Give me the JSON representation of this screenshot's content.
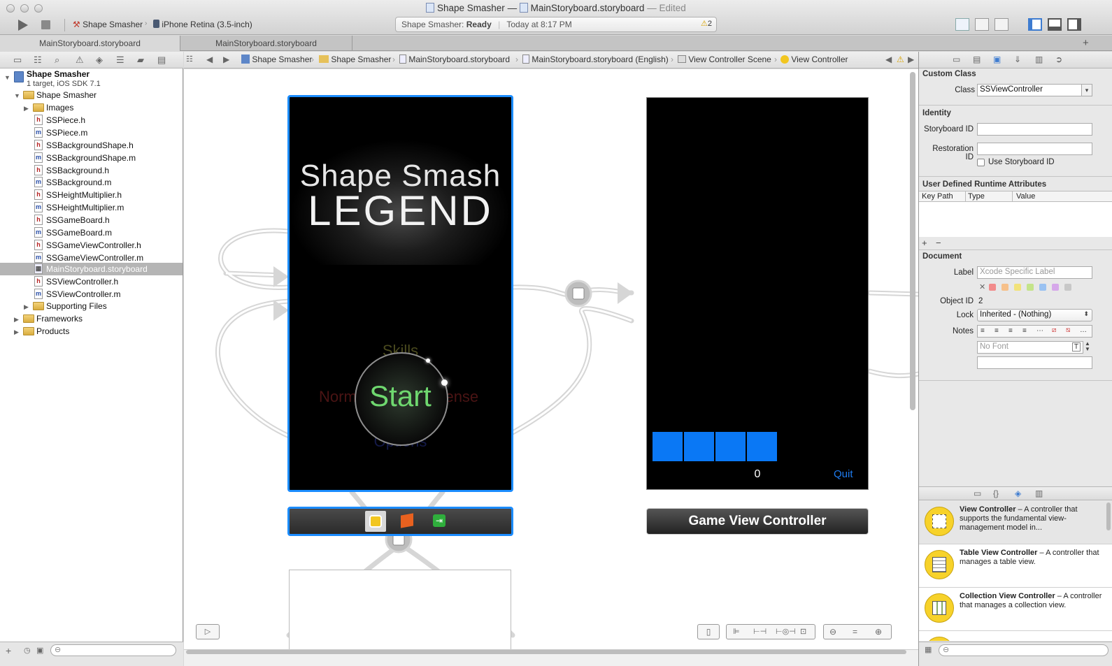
{
  "window": {
    "title_app": "Shape Smasher",
    "title_sep": "—",
    "title_file": "MainStoryboard.storyboard",
    "title_status": "— Edited"
  },
  "toolbar": {
    "scheme": "Shape Smasher",
    "destination": "iPhone Retina (3.5-inch)",
    "status_app": "Shape Smasher:",
    "status_state": "Ready",
    "status_time": "Today at 8:17 PM",
    "warning_count": "2"
  },
  "tabs": [
    {
      "label": "MainStoryboard.storyboard"
    },
    {
      "label": "MainStoryboard.storyboard"
    }
  ],
  "navigator": {
    "project_name": "Shape Smasher",
    "project_sub": "1 target, iOS SDK 7.1",
    "items": [
      {
        "label": "Shape Smasher"
      },
      {
        "label": "Images"
      },
      {
        "label": "SSPiece.h"
      },
      {
        "label": "SSPiece.m"
      },
      {
        "label": "SSBackgroundShape.h"
      },
      {
        "label": "SSBackgroundShape.m"
      },
      {
        "label": "SSBackground.h"
      },
      {
        "label": "SSBackground.m"
      },
      {
        "label": "SSHeightMultiplier.h"
      },
      {
        "label": "SSHeightMultiplier.m"
      },
      {
        "label": "SSGameBoard.h"
      },
      {
        "label": "SSGameBoard.m"
      },
      {
        "label": "SSGameViewController.h"
      },
      {
        "label": "SSGameViewController.m"
      },
      {
        "label": "MainStoryboard.storyboard"
      },
      {
        "label": "SSViewController.h"
      },
      {
        "label": "SSViewController.m"
      },
      {
        "label": "Supporting Files"
      },
      {
        "label": "Frameworks"
      },
      {
        "label": "Products"
      }
    ]
  },
  "jumpbar": {
    "crumbs": [
      "Shape Smasher",
      "Shape Smasher",
      "MainStoryboard.storyboard",
      "MainStoryboard.storyboard (English)",
      "View Controller Scene",
      "View Controller"
    ]
  },
  "canvas": {
    "splash_title": "Shape Smash",
    "splash_subtitle": "LEGEND",
    "menu_skills": "Skills",
    "menu_normal": "Normal",
    "menu_start": "Start",
    "menu_intense": "Intense",
    "menu_options": "Options",
    "game_score": "0",
    "game_quit": "Quit",
    "game_scene_label": "Game View Controller"
  },
  "inspector": {
    "custom_class_header": "Custom Class",
    "class_label": "Class",
    "class_value": "SSViewController",
    "identity_header": "Identity",
    "storyboard_id_label": "Storyboard ID",
    "restoration_id_label": "Restoration ID",
    "use_storyboard_id": "Use Storyboard ID",
    "udra_header": "User Defined Runtime Attributes",
    "col_keypath": "Key Path",
    "col_type": "Type",
    "col_value": "Value",
    "document_header": "Document",
    "label_label": "Label",
    "label_placeholder": "Xcode Specific Label",
    "object_id_label": "Object ID",
    "object_id_value": "2",
    "lock_label": "Lock",
    "lock_value": "Inherited - (Nothing)",
    "notes_label": "Notes",
    "font_placeholder": "No Font"
  },
  "library": [
    {
      "title": "View Controller",
      "desc": " – A controller that supports the fundamental view-management model in..."
    },
    {
      "title": "Table View Controller",
      "desc": " – A controller that manages a table view."
    },
    {
      "title": "Collection View Controller",
      "desc": " – A controller that manages a collection view."
    }
  ],
  "colors": {
    "selection_blue": "#1b8cff",
    "game_block": "#0a78f5",
    "quit_text": "#1e7cf0",
    "start_green": "#6fd86f"
  }
}
